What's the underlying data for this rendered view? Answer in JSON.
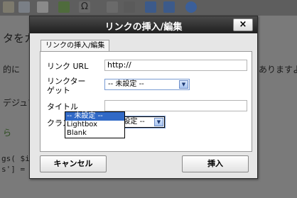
{
  "background": {
    "line1": "タをカ",
    "line2_left": "的に",
    "line2_right": "ありますよ",
    "line3": "デジュア",
    "line4": "ら",
    "code1": "gs( $i",
    "code2": "s'] ="
  },
  "dialog": {
    "title": "リンクの挿入/編集",
    "close_label": "×",
    "tab_label": "リンクの挿入/編集",
    "fields": {
      "url_label": "リンク URL",
      "url_value": "http://",
      "target_label_line1": "リンクター",
      "target_label_line2": "ゲット",
      "target_value": "-- 未設定 --",
      "title_label": "タイトル",
      "title_value": "",
      "class_label": "クラス",
      "class_value": "-- 未設定 --"
    },
    "class_options": [
      "-- 未設定 --",
      "Lightbox",
      "Blank"
    ],
    "cancel_label": "キャンセル",
    "insert_label": "挿入"
  },
  "colors": {
    "title_bar": "#2b2b2b",
    "dialog_bg": "#e6e6e6",
    "selected_option": "#3169c6"
  }
}
